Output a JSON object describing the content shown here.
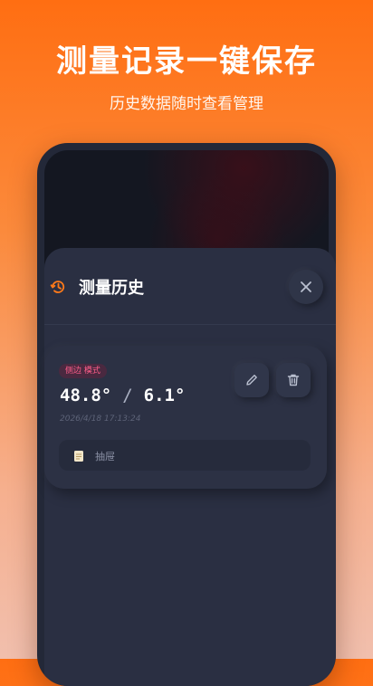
{
  "promo": {
    "headline": "测量记录一键保存",
    "subline": "历史数据随时查看管理"
  },
  "sheet": {
    "title": "测量历史",
    "icon": "history-icon",
    "accent_color": "#ff7a1a"
  },
  "records": [
    {
      "mode_badge": "侧边 模式",
      "value_a": "48.8°",
      "separator": "/",
      "value_b": "6.1°",
      "timestamp": "2026/4/18 17:13:24",
      "note": "抽屉"
    }
  ]
}
